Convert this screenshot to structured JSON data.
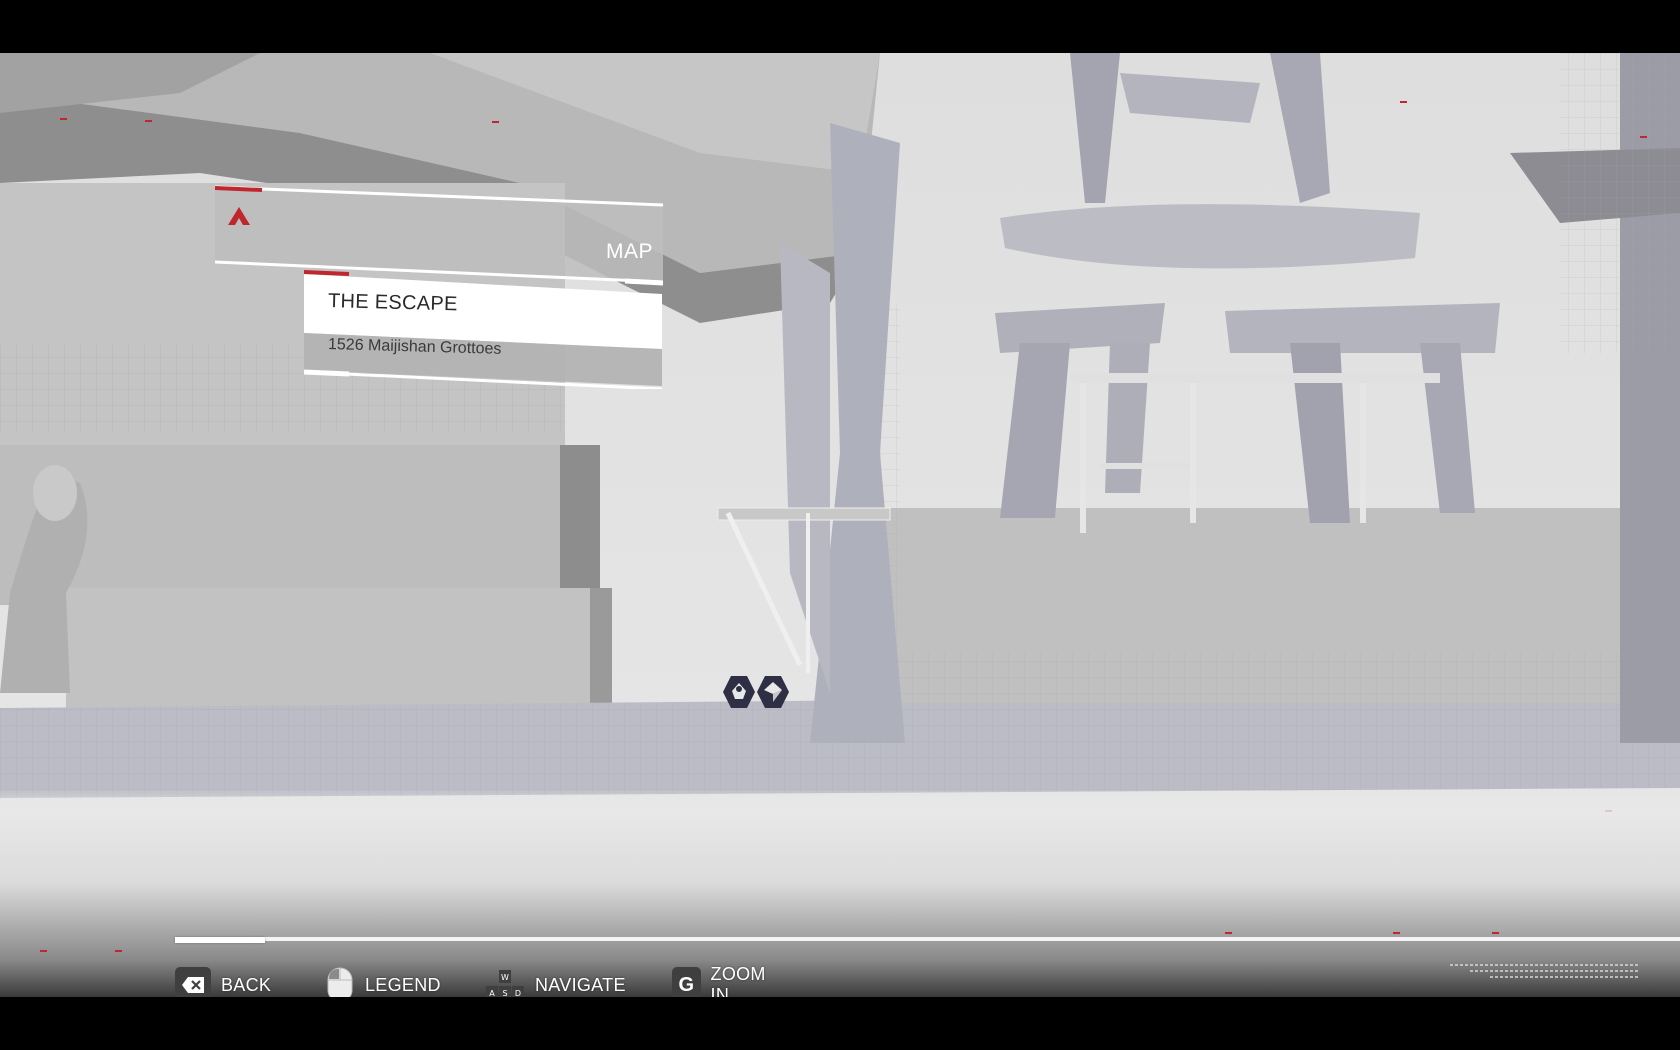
{
  "window": {
    "width": 1680,
    "height": 1050
  },
  "header": {
    "title": "MAP"
  },
  "location": {
    "name": "THE ESCAPE",
    "subtitle": "1526 Maijishan Grottoes"
  },
  "map": {
    "markers": [
      {
        "name": "synchronization-point-icon",
        "interactable": true
      },
      {
        "name": "helix-fragment-icon",
        "interactable": true
      }
    ],
    "progress": 0.06
  },
  "controls": {
    "back": {
      "key_icon": "backspace-icon",
      "label": "BACK"
    },
    "legend": {
      "key_icon": "mouse-icon",
      "label": "LEGEND"
    },
    "navigate": {
      "key_icon": "wasd-icon",
      "keys": [
        "W",
        "A",
        "S",
        "D"
      ],
      "label": "NAVIGATE"
    },
    "zoom": {
      "key": "G",
      "label": "ZOOM IN"
    }
  },
  "colors": {
    "accent": "#c0262e",
    "panel": "#ffffff",
    "key_bg": "#3f3f3f"
  }
}
